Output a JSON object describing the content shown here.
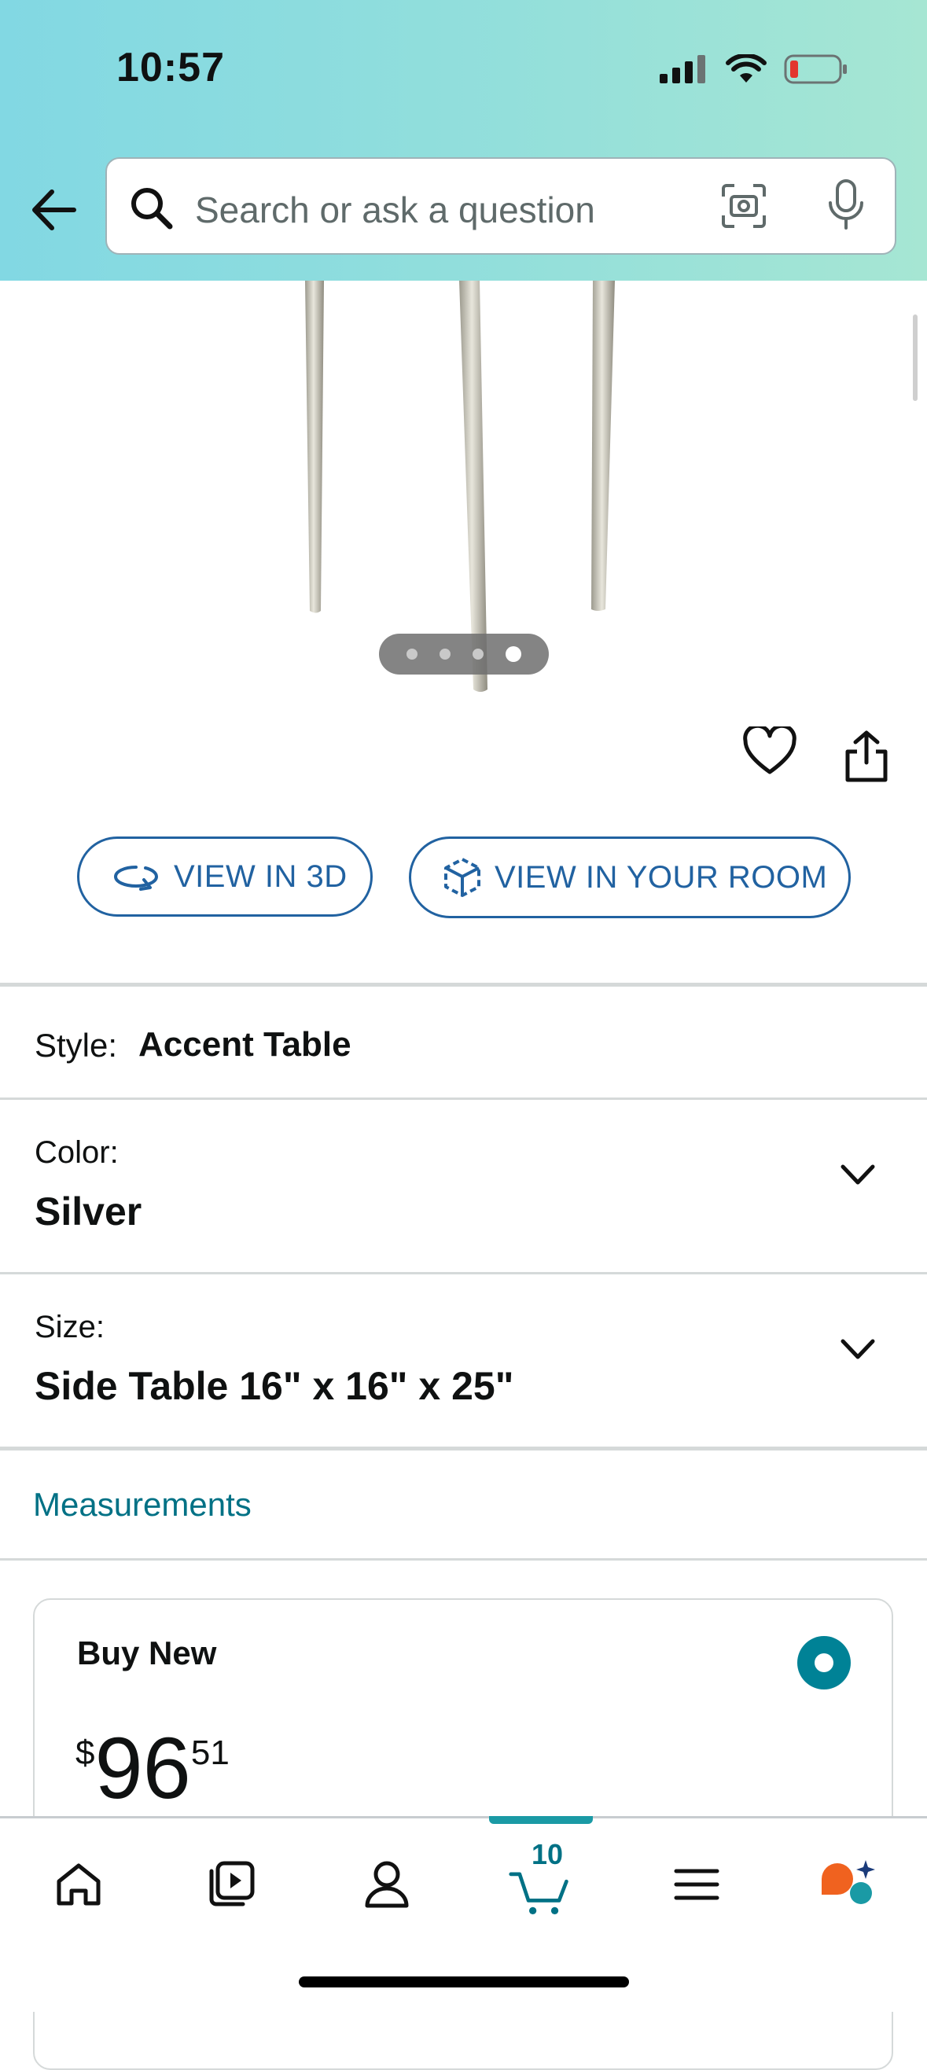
{
  "status_bar": {
    "time": "10:57"
  },
  "search": {
    "placeholder": "Search or ask a question"
  },
  "gallery": {
    "dots": 4,
    "active_index": 3
  },
  "actions": {
    "view_3d": "VIEW IN 3D",
    "view_room": "VIEW IN YOUR ROOM"
  },
  "style_row": {
    "label": "Style:",
    "value": "Accent Table"
  },
  "color_row": {
    "label": "Color:",
    "value": "Silver"
  },
  "size_row": {
    "label": "Size:",
    "value": "Side Table 16\" x 16\" x 25\""
  },
  "measurements_link": "Measurements",
  "buy_box": {
    "title": "Buy New",
    "currency": "$",
    "price_whole": "96",
    "price_fraction": "51"
  },
  "tab_bar": {
    "items": [
      "home-icon",
      "video-icon",
      "profile-icon",
      "cart-icon",
      "menu-icon",
      "rufus-icon"
    ],
    "cart_count": "10",
    "active": "cart"
  },
  "colors": {
    "link": "#007185",
    "button_blue": "#2162a1",
    "teal": "#008296",
    "rufus_orange": "#f0621f"
  }
}
